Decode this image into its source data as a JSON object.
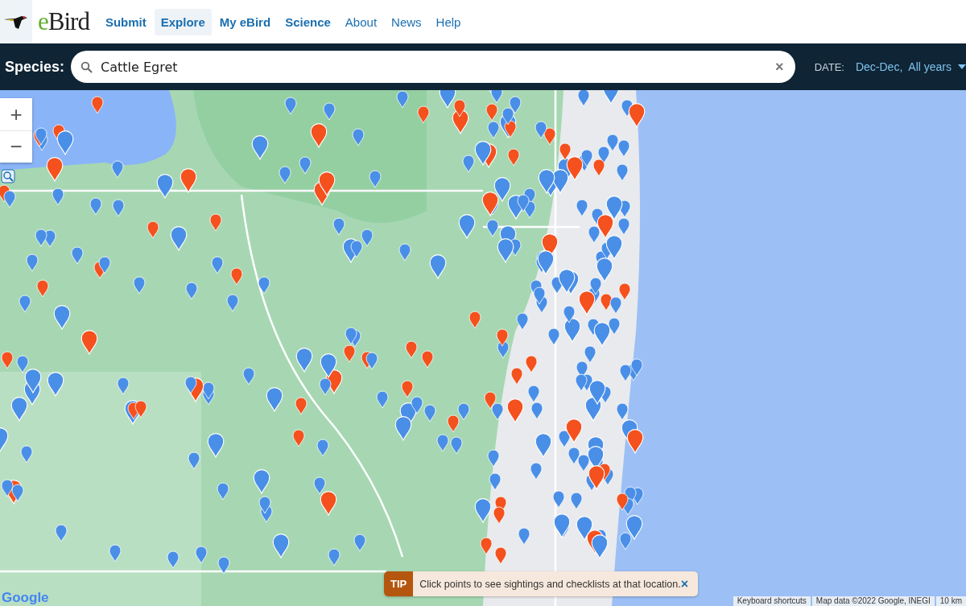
{
  "header": {
    "logo": "eBird",
    "nav": [
      {
        "label": "Submit",
        "kind": "primary",
        "selected": false
      },
      {
        "label": "Explore",
        "kind": "primary",
        "selected": true
      },
      {
        "label": "My eBird",
        "kind": "primary",
        "selected": false
      },
      {
        "label": "Science",
        "kind": "primary",
        "selected": false
      },
      {
        "label": "About",
        "kind": "secondary",
        "selected": false
      },
      {
        "label": "News",
        "kind": "secondary",
        "selected": false
      },
      {
        "label": "Help",
        "kind": "secondary",
        "selected": false
      }
    ]
  },
  "species_bar": {
    "label": "Species:",
    "search": {
      "value": "Cattle Egret",
      "clear": "×"
    },
    "date_label": "DATE:",
    "date_value": "Dec-Dec,  All years"
  },
  "map": {
    "zoom_in": "+",
    "zoom_out": "−",
    "logo": "Google",
    "attribution": [
      "Keyboard shortcuts",
      "Map data ©2022 Google, INEGI",
      "10 km"
    ]
  },
  "tip": {
    "badge": "TIP",
    "text": "Click points to see sightings and checklists at that location.",
    "close": "×"
  }
}
